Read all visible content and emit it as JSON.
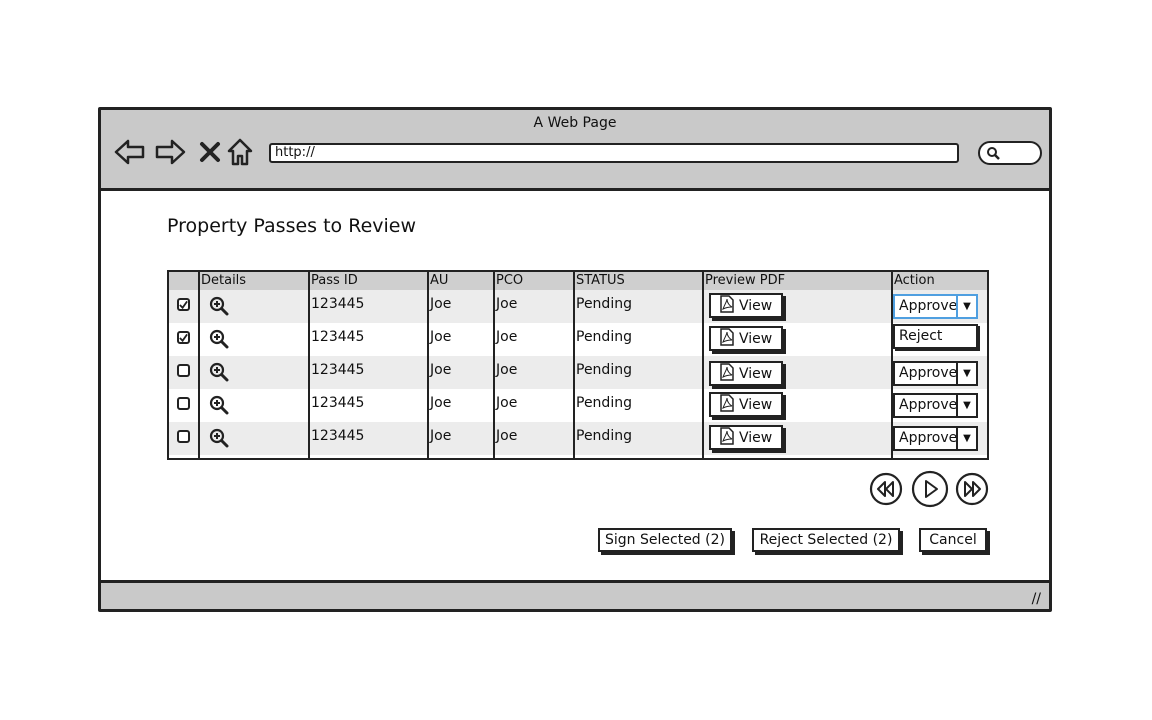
{
  "window": {
    "title": "A Web Page",
    "url": "http://",
    "resize_glyph": "//"
  },
  "page": {
    "heading": "Property Passes to Review"
  },
  "table": {
    "columns": [
      "Details",
      "Pass ID",
      "AU",
      "PCO",
      "STATUS",
      "Preview PDF",
      "Action"
    ],
    "rows": [
      {
        "checked": true,
        "pass_id": "123445",
        "au": "Joe",
        "pco": "Joe",
        "status": "Pending",
        "view": "View",
        "action": "Approve"
      },
      {
        "checked": true,
        "pass_id": "123445",
        "au": "Joe",
        "pco": "Joe",
        "status": "Pending",
        "view": "View",
        "action": "Reject"
      },
      {
        "checked": false,
        "pass_id": "123445",
        "au": "Joe",
        "pco": "Joe",
        "status": "Pending",
        "view": "View",
        "action": "Approve"
      },
      {
        "checked": false,
        "pass_id": "123445",
        "au": "Joe",
        "pco": "Joe",
        "status": "Pending",
        "view": "View",
        "action": "Approve"
      },
      {
        "checked": false,
        "pass_id": "123445",
        "au": "Joe",
        "pco": "Joe",
        "status": "Pending",
        "view": "View",
        "action": "Approve"
      }
    ]
  },
  "buttons": {
    "sign_selected": "Sign Selected (2)",
    "reject_selected": "Reject Selected (2)",
    "cancel": "Cancel"
  },
  "icons": [
    "back-icon",
    "forward-icon",
    "close-icon",
    "home-icon",
    "search-icon",
    "zoom-in-icon",
    "pdf-icon",
    "chevron-down-icon",
    "rewind-icon",
    "play-icon",
    "fast-forward-icon"
  ],
  "colors": {
    "chrome": "#c9c9c9",
    "header": "#cfcfcf",
    "alt_row": "#ececec",
    "focus": "#4f9fe0"
  }
}
